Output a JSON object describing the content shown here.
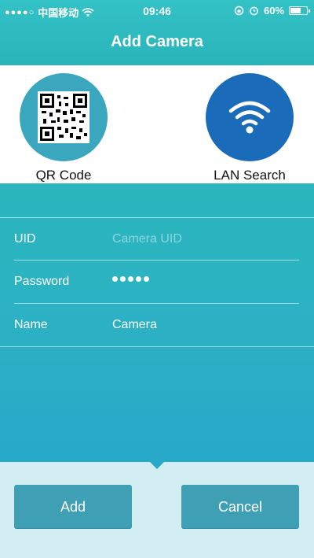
{
  "status_bar": {
    "carrier": "中国移动",
    "time": "09:46",
    "battery": "60%"
  },
  "header": {
    "title": "Add Camera"
  },
  "options": {
    "qr": {
      "label": "QR Code",
      "icon": "qr-code-icon"
    },
    "lan": {
      "label": "LAN Search",
      "icon": "wifi-icon"
    }
  },
  "form": {
    "uid": {
      "label": "UID",
      "placeholder": "Camera UID",
      "value": ""
    },
    "password": {
      "label": "Password",
      "masked_length": 5
    },
    "name": {
      "label": "Name",
      "value": "Camera"
    }
  },
  "buttons": {
    "add": "Add",
    "cancel": "Cancel"
  },
  "colors": {
    "header": "#2fbcc1",
    "qr_circle": "#3aa7bf",
    "lan_circle": "#1a6cbb",
    "button": "#3e9fb5",
    "bottom_bg": "#d2eef2"
  }
}
